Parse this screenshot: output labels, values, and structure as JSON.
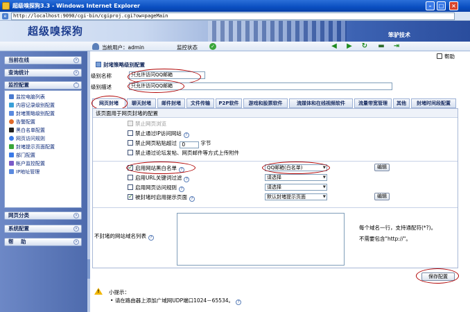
{
  "browser": {
    "title": "超级嗅探狗3.3 - Windows Internet Explorer",
    "url": "http://localhost:9090/cgi-bin/cgiproj.cgi?ow=pageMain"
  },
  "header": {
    "logo": "超级嗅探狗",
    "brand": "笨驴技术"
  },
  "status": {
    "user": "当前用户：admin",
    "state_label": "监控状态"
  },
  "sidebar": {
    "sections_top": [
      "当前在线",
      "查询统计",
      "监控配置"
    ],
    "menu_items": [
      {
        "label": "监控电脑列表",
        "color": "#4a7bd0"
      },
      {
        "label": "内容记录级别配置",
        "color": "#3aa0d8"
      },
      {
        "label": "封堵策略级别配置",
        "color": "#5a8ae0"
      },
      {
        "label": "告警配置",
        "color": "#e06a2a"
      },
      {
        "label": "黑白名单配置",
        "color": "#222222"
      },
      {
        "label": "网页访问规则",
        "color": "#3a7ae8"
      },
      {
        "label": "封堵提示页面配置",
        "color": "#3aa63a"
      },
      {
        "label": "部门配置",
        "color": "#3a7ae8"
      },
      {
        "label": "帐户监控配置",
        "color": "#7a5ac8"
      },
      {
        "label": "IP地址管理",
        "color": "#5a8ae0"
      }
    ],
    "sections_bottom": [
      "网页分类",
      "系统配置",
      "帮    助"
    ]
  },
  "main": {
    "help_label": "帮助",
    "section_title": "封堵策略级别配置",
    "form": {
      "name_label": "级别名称",
      "name_value": "只允许访问QQ邮箱",
      "desc_label": "级别描述",
      "desc_value": "只允许访问QQ邮箱"
    },
    "tabs": [
      "网页封堵",
      "聊天封堵",
      "邮件封堵",
      "文件传输",
      "P2P软件",
      "游戏和股票软件",
      "流媒体和在线视频软件",
      "流量带宽管理",
      "其他",
      "封堵时间段配置"
    ],
    "panel_header": "该页面用于网页封堵的配置",
    "options": {
      "forbid_browse": "禁止网页浏览",
      "forbid_ip": "禁止通过IP访问网站",
      "forbid_size_prefix": "禁止网页粘贴超过",
      "forbid_size_value": "0",
      "forbid_size_suffix": "字节",
      "forbid_upload": "禁止通过论坛发帖、网页邮件等方式上传附件"
    },
    "rules": [
      {
        "label": "启用网站黑白名单",
        "checked": true,
        "select": "QQ邮箱(白名单)",
        "edit": "编辑"
      },
      {
        "label": "启用URL关键词过滤",
        "checked": false,
        "select": "请选择"
      },
      {
        "label": "启用网页访问规则",
        "checked": false,
        "select": "请选择"
      },
      {
        "label": "被封堵时启用提示页面",
        "checked": true,
        "select": "默认封堵提示页面",
        "edit": "编辑"
      }
    ],
    "unblocked": {
      "label": "不封堵的网站域名列表",
      "hint1": "每个域名一行，支持通配符(*?)。",
      "hint2": "不需要包含\"http://\"。"
    },
    "save_label": "保存配置",
    "tips": {
      "title": "小提示：",
      "item": "请在路由器上添加广域网UDP端口1024－65534。"
    }
  }
}
